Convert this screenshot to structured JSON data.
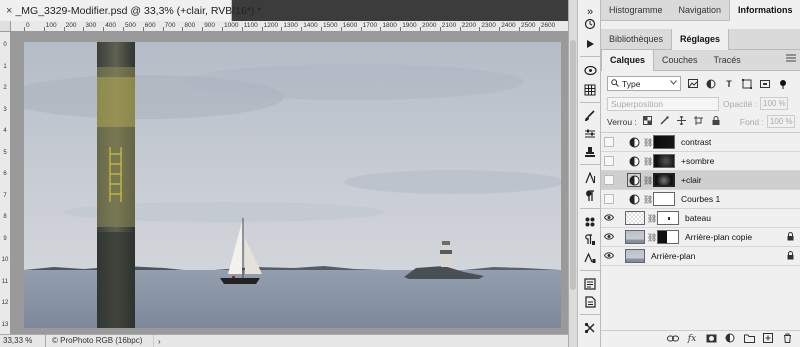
{
  "document": {
    "tab_title": "_MG_3329-Modifier.psd @ 33,3% (+clair, RVB/16*) *",
    "close_glyph": "×"
  },
  "ruler": {
    "top_labels": [
      "0",
      "100",
      "200",
      "300",
      "400",
      "500",
      "600",
      "700",
      "800",
      "900",
      "1000",
      "1100",
      "1200",
      "1300",
      "1400",
      "1500",
      "1600",
      "1700",
      "1800",
      "1900",
      "2000",
      "2100",
      "2200",
      "2300",
      "2400",
      "2500",
      "2600"
    ],
    "left_labels": [
      "0",
      "1",
      "2",
      "3",
      "4",
      "5",
      "6",
      "7",
      "8",
      "9",
      "10",
      "11",
      "12",
      "13"
    ]
  },
  "status": {
    "zoom": "33,33 %",
    "profile": "© ProPhoto RGB (16bpc)",
    "arrow": "›"
  },
  "top_panel": {
    "row1_tabs": [
      "Histogramme",
      "Navigation",
      "Informations"
    ],
    "row1_active": 2,
    "row2_tabs": [
      "Bibliothèques",
      "Réglages"
    ],
    "row2_active": 1
  },
  "layers_panel": {
    "tabs": [
      "Calques",
      "Couches",
      "Tracés"
    ],
    "active_tab": 0,
    "filter_value": "Type",
    "blend_mode": "Superposition",
    "opacity_label": "Opacité :",
    "opacity_value": "100 %",
    "lock_label": "Verrou :",
    "fill_label": "Fond :",
    "fill_value": "100 %",
    "layers": [
      {
        "name": "contrast",
        "visible": false,
        "type": "adjustment",
        "mask": "dark",
        "selected": false,
        "locked": false
      },
      {
        "name": "+sombre",
        "visible": false,
        "type": "adjustment",
        "mask": "dark-soft",
        "selected": false,
        "locked": false
      },
      {
        "name": "+clair",
        "visible": false,
        "type": "adjustment",
        "mask": "dark-soft",
        "selected": true,
        "locked": false
      },
      {
        "name": "Courbes 1",
        "visible": false,
        "type": "adjustment",
        "mask": "white",
        "selected": false,
        "locked": false
      },
      {
        "name": "bateau",
        "visible": true,
        "type": "pixel",
        "mask": "white-dot",
        "selected": false,
        "locked": false
      },
      {
        "name": "Arrière-plan copie",
        "visible": true,
        "type": "pixel",
        "mask": "half",
        "selected": false,
        "locked": true
      },
      {
        "name": "Arrière-plan",
        "visible": true,
        "type": "background",
        "mask": "none",
        "selected": false,
        "locked": true
      }
    ]
  },
  "colors": {
    "ui_dark": "#535353",
    "panel_bg": "#f0f0f0",
    "selected_row": "#cfcfcf",
    "sky_top": "#b9c1cc",
    "sea": "#8995a6"
  }
}
